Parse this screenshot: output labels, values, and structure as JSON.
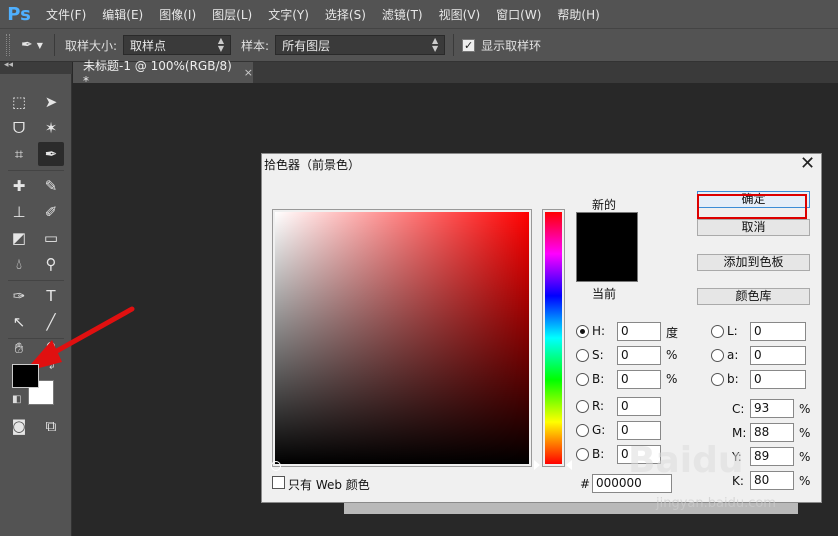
{
  "app": {
    "logo": "Ps"
  },
  "menu": [
    "文件(F)",
    "编辑(E)",
    "图像(I)",
    "图层(L)",
    "文字(Y)",
    "选择(S)",
    "滤镜(T)",
    "视图(V)",
    "窗口(W)",
    "帮助(H)"
  ],
  "options_bar": {
    "sample_size_label": "取样大小:",
    "sample_size_value": "取样点",
    "sample_label": "样本:",
    "sample_value": "所有图层",
    "show_ring_label": "显示取样环",
    "show_ring_checked": true
  },
  "document": {
    "tab_title": "未标题-1 @ 100%(RGB/8) *",
    "close": "×"
  },
  "tools": {
    "fg_color": "#000000",
    "bg_color": "#ffffff",
    "icons": [
      "marquee-icon",
      "move-icon",
      "lasso-icon",
      "magic-wand-icon",
      "crop-icon",
      "eyedropper-icon",
      "healing-icon",
      "brush-icon",
      "stamp-icon",
      "history-brush-icon",
      "eraser-icon",
      "gradient-icon",
      "blur-icon",
      "dodge-icon",
      "pen-icon",
      "type-icon",
      "path-select-icon",
      "line-icon",
      "hand-icon",
      "zoom-icon"
    ]
  },
  "dialog": {
    "title": "拾色器（前景色）",
    "close": "✕",
    "new_label": "新的",
    "current_label": "当前",
    "ok": "确定",
    "cancel": "取消",
    "add_swatch": "添加到色板",
    "color_library": "颜色库",
    "web_only": "只有 Web 颜色",
    "hex_label": "#",
    "hex_value": "000000",
    "hsb": [
      {
        "label": "H:",
        "value": "0",
        "unit": "度",
        "selected": true
      },
      {
        "label": "S:",
        "value": "0",
        "unit": "%",
        "selected": false
      },
      {
        "label": "B:",
        "value": "0",
        "unit": "%",
        "selected": false
      }
    ],
    "rgb": [
      {
        "label": "R:",
        "value": "0"
      },
      {
        "label": "G:",
        "value": "0"
      },
      {
        "label": "B:",
        "value": "0"
      }
    ],
    "lab": [
      {
        "label": "L:",
        "value": "0"
      },
      {
        "label": "a:",
        "value": "0"
      },
      {
        "label": "b:",
        "value": "0"
      }
    ],
    "cmyk": [
      {
        "label": "C:",
        "value": "93",
        "unit": "%"
      },
      {
        "label": "M:",
        "value": "88",
        "unit": "%"
      },
      {
        "label": "Y:",
        "value": "89",
        "unit": "%"
      },
      {
        "label": "K:",
        "value": "80",
        "unit": "%"
      }
    ]
  },
  "accent": {
    "annotation_red": "#dd0000",
    "ok_border": "#3c8dd6"
  },
  "watermark": {
    "logo": "Baidu",
    "site": "jingyan.baidu.com"
  }
}
